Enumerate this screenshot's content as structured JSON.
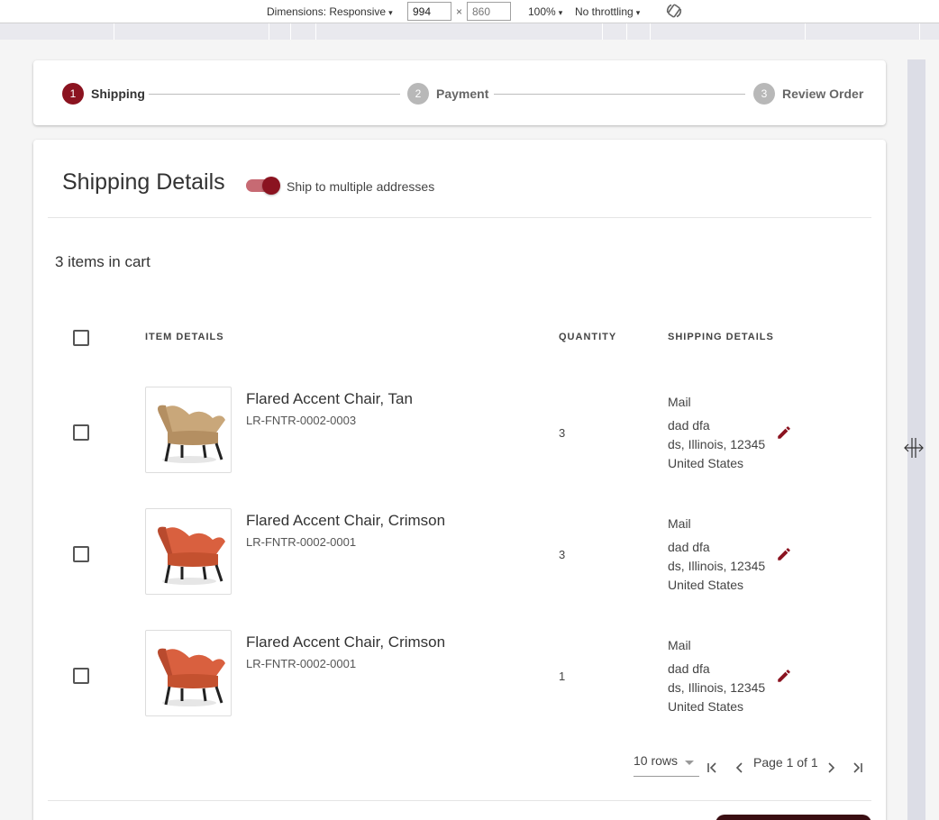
{
  "devtools": {
    "dimensions_label": "Dimensions: Responsive",
    "width": "994",
    "height": "860",
    "times": "×",
    "zoom": "100%",
    "throttling": "No throttling",
    "caret": "▾"
  },
  "stepper": {
    "steps": [
      {
        "number": "1",
        "label": "Shipping"
      },
      {
        "number": "2",
        "label": "Payment"
      },
      {
        "number": "3",
        "label": "Review Order"
      }
    ]
  },
  "shipping": {
    "title": "Shipping Details",
    "toggle_label": "Ship to multiple addresses",
    "toggle_on": true,
    "items_count": "3 items in cart"
  },
  "table": {
    "headers": {
      "item_details": "ITEM DETAILS",
      "quantity": "QUANTITY",
      "shipping_details": "SHIPPING DETAILS"
    },
    "rows": [
      {
        "name": "Flared Accent Chair, Tan",
        "sku": "LR-FNTR-0002-0003",
        "quantity": "3",
        "method": "Mail",
        "address_line1": "dad dfa",
        "address_line2": "ds, Illinois, 12345",
        "address_line3": "United States",
        "color": "tan"
      },
      {
        "name": "Flared Accent Chair, Crimson",
        "sku": "LR-FNTR-0002-0001",
        "quantity": "3",
        "method": "Mail",
        "address_line1": "dad dfa",
        "address_line2": "ds, Illinois, 12345",
        "address_line3": "United States",
        "color": "crimson"
      },
      {
        "name": "Flared Accent Chair, Crimson",
        "sku": "LR-FNTR-0002-0001",
        "quantity": "1",
        "method": "Mail",
        "address_line1": "dad dfa",
        "address_line2": "ds, Illinois, 12345",
        "address_line3": "United States",
        "color": "crimson"
      }
    ]
  },
  "pagination": {
    "rows_per_page": "10 rows",
    "page_label": "Page 1 of 1"
  },
  "colors": {
    "accent": "#8b1320",
    "toggle_track": "#c76a73",
    "tan_chair": "#c9a77a",
    "crimson_chair": "#d9603f"
  }
}
